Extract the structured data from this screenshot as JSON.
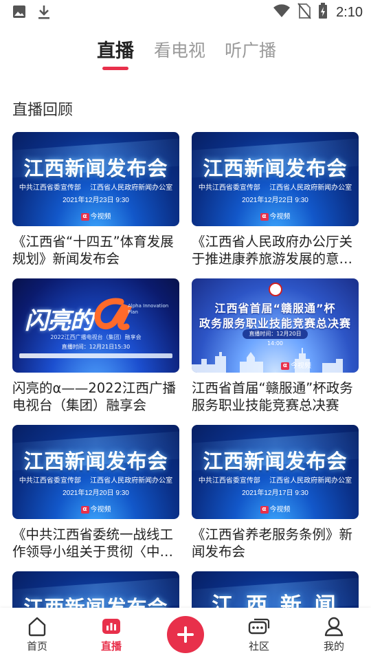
{
  "status_bar": {
    "time": "2:10",
    "icons": [
      "image-icon",
      "download-icon",
      "wifi-icon",
      "no-sim-icon",
      "battery-charging-icon"
    ]
  },
  "tabs": [
    {
      "label": "直播",
      "active": true
    },
    {
      "label": "看电视",
      "active": false
    },
    {
      "label": "听广播",
      "active": false
    }
  ],
  "section_title": "直播回顾",
  "cards": [
    {
      "thumb_style": "presser",
      "thumb_title": "江西新闻发布会",
      "thumb_org": "中共江西省委宣传部 江西省人民政府新闻办公室",
      "thumb_date": "2021年12月23日 9:30",
      "thumb_logo": "今视频",
      "caption": "《江西省“十四五”体育发展规划》新闻发布会"
    },
    {
      "thumb_style": "presser",
      "thumb_title": "江西新闻发布会",
      "thumb_org": "中共江西省委宣传部 江西省人民政府新闻办公室",
      "thumb_date": "2021年12月22日 9:30",
      "thumb_logo": "今视频",
      "caption": "《江西省人民政府办公厅关于推进康养旅游发展的意见》新闻发布会"
    },
    {
      "thumb_style": "alpha",
      "thumb_title": "闪亮的",
      "thumb_en": "Alpha Innovation Plan",
      "thumb_sub": "2022江西广播电视台（集团）融享会",
      "thumb_date": "直播时间：12月21日15:30",
      "caption": "闪亮的α——2022江西广播电视台（集团）融享会"
    },
    {
      "thumb_style": "contest",
      "thumb_line1": "江西省首届“赣服通”杯",
      "thumb_line2": "政务服务职业技能竞赛总决赛",
      "thumb_date": "直播时间：12月20日 14:00",
      "thumb_logo": "今视频",
      "caption": "江西省首届“赣服通”杯政务服务职业技能竞赛总决赛"
    },
    {
      "thumb_style": "presser",
      "thumb_title": "江西新闻发布会",
      "thumb_org": "中共江西省委宣传部 江西省人民政府新闻办公室",
      "thumb_date": "2021年12月20日 9:30",
      "thumb_logo": "今视频",
      "caption": "《中共江西省委统一战线工作领导小组关于贯彻〈中国共产党统一战线工作条例〉的实施办法》新闻发布会"
    },
    {
      "thumb_style": "presser",
      "thumb_title": "江西新闻发布会",
      "thumb_org": "中共江西省委宣传部 江西省人民政府新闻办公室",
      "thumb_date": "2021年12月17日 9:30",
      "thumb_logo": "今视频",
      "caption": "《江西省养老服务条例》新闻发布会"
    },
    {
      "thumb_style": "presser",
      "thumb_title": "江西新闻发布会",
      "caption": ""
    },
    {
      "thumb_style": "presser",
      "thumb_title": "江 西 新 闻",
      "caption": ""
    }
  ],
  "bottom_nav": [
    {
      "label": "首页",
      "icon": "home-icon",
      "active": false
    },
    {
      "label": "直播",
      "icon": "live-chart-icon",
      "active": true
    },
    {
      "label": "",
      "icon": "plus-icon",
      "active": false
    },
    {
      "label": "社区",
      "icon": "community-chat-icon",
      "active": false
    },
    {
      "label": "我的",
      "icon": "profile-icon",
      "active": false
    }
  ],
  "colors": {
    "accent": "#e8304b",
    "inactive_tab": "#9a9a9a",
    "text": "#222222"
  }
}
